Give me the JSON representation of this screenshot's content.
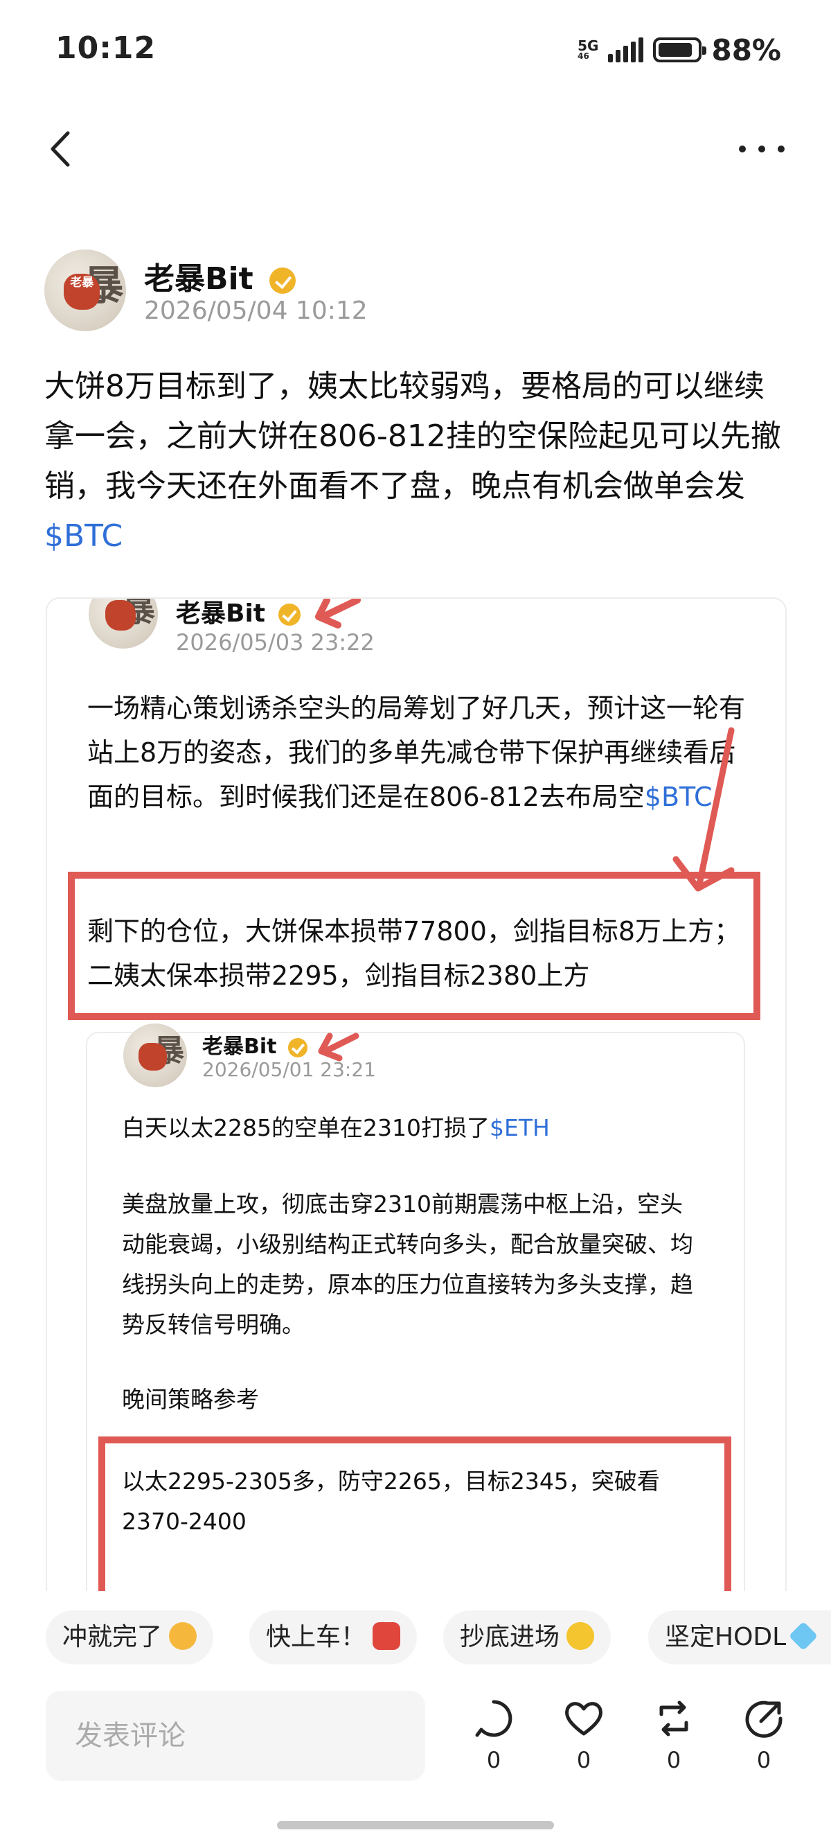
{
  "status_bar": {
    "time": "10:12",
    "network": "5G",
    "network_sub": "46",
    "battery": "88%",
    "battery_level": 0.88
  },
  "post": {
    "author": "老暴Bit",
    "avatar_text": "老暴",
    "time": "2026/05/04 10:12",
    "body": "大饼8万目标到了，姨太比较弱鸡，要格局的可以继续拿一会，之前大饼在806-812挂的空保险起见可以先撤销，我今天还在外面看不了盘，晚点有机会做单会发",
    "tag": "$BTC"
  },
  "quote1": {
    "author": "老暴Bit",
    "time": "2026/05/03 23:22",
    "body": "一场精心策划诱杀空头的局筹划了好几天，预计这一轮有站上8万的姿态，我们的多单先减仓带下保护再继续看后面的目标。到时候我们还是在806-812去布局空",
    "tag": "$BTC",
    "highlight": "剩下的仓位，大饼保本损带77800，剑指目标8万上方；二姨太保本损带2295，剑指目标2380上方"
  },
  "quote2": {
    "author": "老暴Bit",
    "time": "2026/05/01 23:21",
    "line1": "白天以太2285的空单在2310打损了",
    "tag": "$ETH",
    "para": "美盘放量上攻，彻底击穿2310前期震荡中枢上沿，空头动能衰竭，小级别结构正式转向多头，配合放量突破、均线拐头向上的走势，原本的压力位直接转为多头支撑，趋势反转信号明确。",
    "strategy_title": "晚间策略参考",
    "strategy": "以太2295-2305多，防守2265，目标2345，突破看2370-2400"
  },
  "reactions": [
    {
      "label": "冲就完了",
      "emoji": "fist-emoji"
    },
    {
      "label": "快上车！",
      "emoji": "car-emoji"
    },
    {
      "label": "抄底进场",
      "emoji": "sunglasses-emoji"
    },
    {
      "label": "坚定HODL",
      "emoji": "diamond-emoji"
    }
  ],
  "bottom_bar": {
    "comment_placeholder": "发表评论",
    "comments": "0",
    "likes": "0",
    "reposts": "0",
    "shares": "0"
  },
  "colors": {
    "accent_blue": "#2f6fd8",
    "highlight_red": "#e05a55",
    "verified_gold": "#f0b429"
  }
}
